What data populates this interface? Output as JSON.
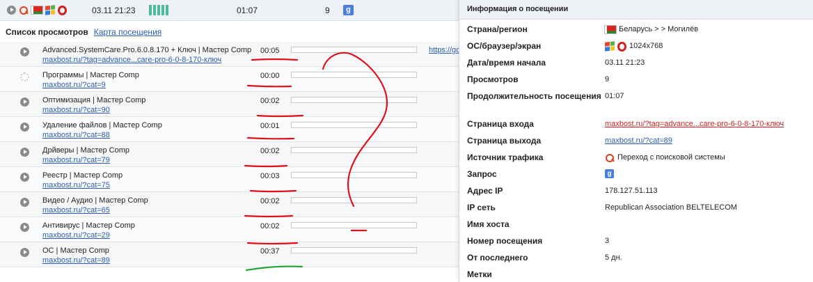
{
  "summary": {
    "date": "03.11 21:23",
    "duration": "01:07",
    "views": "9",
    "search_engine": "g"
  },
  "tabs": {
    "views_list": "Список просмотров",
    "visit_map": "Карта посещения"
  },
  "pages": [
    {
      "title": "Advanced.SystemCare.Pro.6.0.8.170 + Ключ | Мастер Comp",
      "url": "maxbost.ru/?tag=advance...care-pro-6-0-8-170-ключ",
      "time": "00:05",
      "external": "https://go"
    },
    {
      "title": "Программы | Мастер Comp",
      "url": "maxbost.ru/?cat=9",
      "time": "00:00",
      "external": ""
    },
    {
      "title": "Оптимизация | Мастер Comp",
      "url": "maxbost.ru/?cat=90",
      "time": "00:02",
      "external": ""
    },
    {
      "title": "Удаление файлов | Мастер Comp",
      "url": "maxbost.ru/?cat=88",
      "time": "00:01",
      "external": ""
    },
    {
      "title": "Дрйверы | Мастер Comp",
      "url": "maxbost.ru/?cat=79",
      "time": "00:02",
      "external": ""
    },
    {
      "title": "Реестр | Мастер Comp",
      "url": "maxbost.ru/?cat=75",
      "time": "00:03",
      "external": ""
    },
    {
      "title": "Видео / Аудио | Мастер Comp",
      "url": "maxbost.ru/?cat=65",
      "time": "00:02",
      "external": ""
    },
    {
      "title": "Антивирус | Мастер Comp",
      "url": "maxbost.ru/?cat=29",
      "time": "00:02",
      "external": ""
    },
    {
      "title": "ОС | Мастер Comp",
      "url": "maxbost.ru/?cat=89",
      "time": "00:37",
      "external": ""
    }
  ],
  "info": {
    "heading": "Информация о посещении",
    "rows": {
      "country_label": "Страна/регион",
      "country_value": "Беларусь > > Могилёв",
      "os_label": "ОС/браузер/экран",
      "os_value": "1024x768",
      "start_label": "Дата/время начала",
      "start_value": "03.11 21:23",
      "views_label": "Просмотров",
      "views_value": "9",
      "duration_label": "Продолжительность посещения",
      "duration_value": "01:07",
      "entry_label": "Страница входа",
      "entry_value": "maxbost.ru/?tag=advance...care-pro-6-0-8-170-ключ",
      "exit_label": "Страница выхода",
      "exit_value": "maxbost.ru/?cat=89",
      "source_label": "Источник трафика",
      "source_value": "Переход с поисковой системы",
      "query_label": "Запрос",
      "ip_label": "Адрес IP",
      "ip_value": "178.127.51.113",
      "net_label": "IP сеть",
      "net_value": "Republican Association BELTELECOM",
      "host_label": "Имя хоста",
      "visit_no_label": "Номер посещения",
      "visit_no_value": "3",
      "since_label": "От последнего",
      "since_value": "5 дн.",
      "tags_label": "Метки"
    }
  },
  "colors": {
    "accent_link": "#2a5db0",
    "annotation_red": "#e0101a",
    "annotation_green": "#22a33a",
    "activity_bar": "#4dbb97"
  }
}
